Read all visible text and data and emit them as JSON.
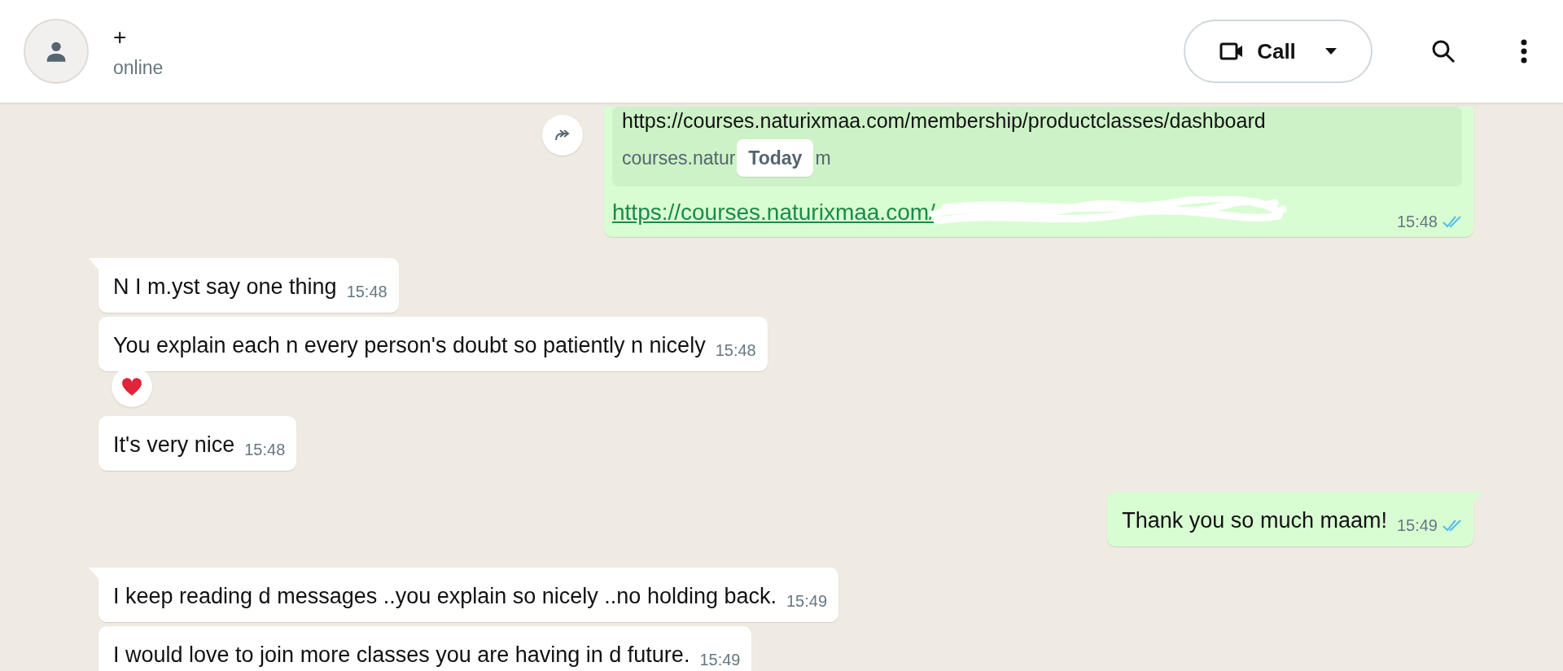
{
  "header": {
    "contact_name": "+",
    "status": "online",
    "call_button": {
      "label": "Call"
    }
  },
  "date_chip": "Today",
  "messages": [
    {
      "kind": "outgoing_link",
      "tail": false,
      "show_forward": true,
      "preview_title": "https://courses.naturixmaa.com/membership/productclasses/dashboard",
      "preview_domain_start": "courses.natur",
      "preview_domain_end": "m",
      "link": "https://courses.naturixmaa.com/",
      "redacted": true,
      "time": "15:48",
      "read": true
    },
    {
      "kind": "incoming_text",
      "tail": true,
      "text": "N I m.yst say one thing",
      "time": "15:48"
    },
    {
      "kind": "incoming_text",
      "tail": false,
      "text": "You explain each n every person's doubt so patiently n nicely",
      "time": "15:48",
      "reacted": true
    },
    {
      "kind": "incoming_text",
      "tail": false,
      "text": "It's very nice",
      "time": "15:48"
    },
    {
      "kind": "outgoing_text",
      "tail": true,
      "text": "Thank you so much maam!",
      "time": "15:49",
      "read": true
    },
    {
      "kind": "incoming_text",
      "tail": true,
      "text": "I keep reading d messages ..you explain so nicely ..no holding back.",
      "time": "15:49"
    },
    {
      "kind": "incoming_text",
      "tail": false,
      "text": "I would love to join more classes you are having in d future.",
      "time": "15:49"
    }
  ]
}
